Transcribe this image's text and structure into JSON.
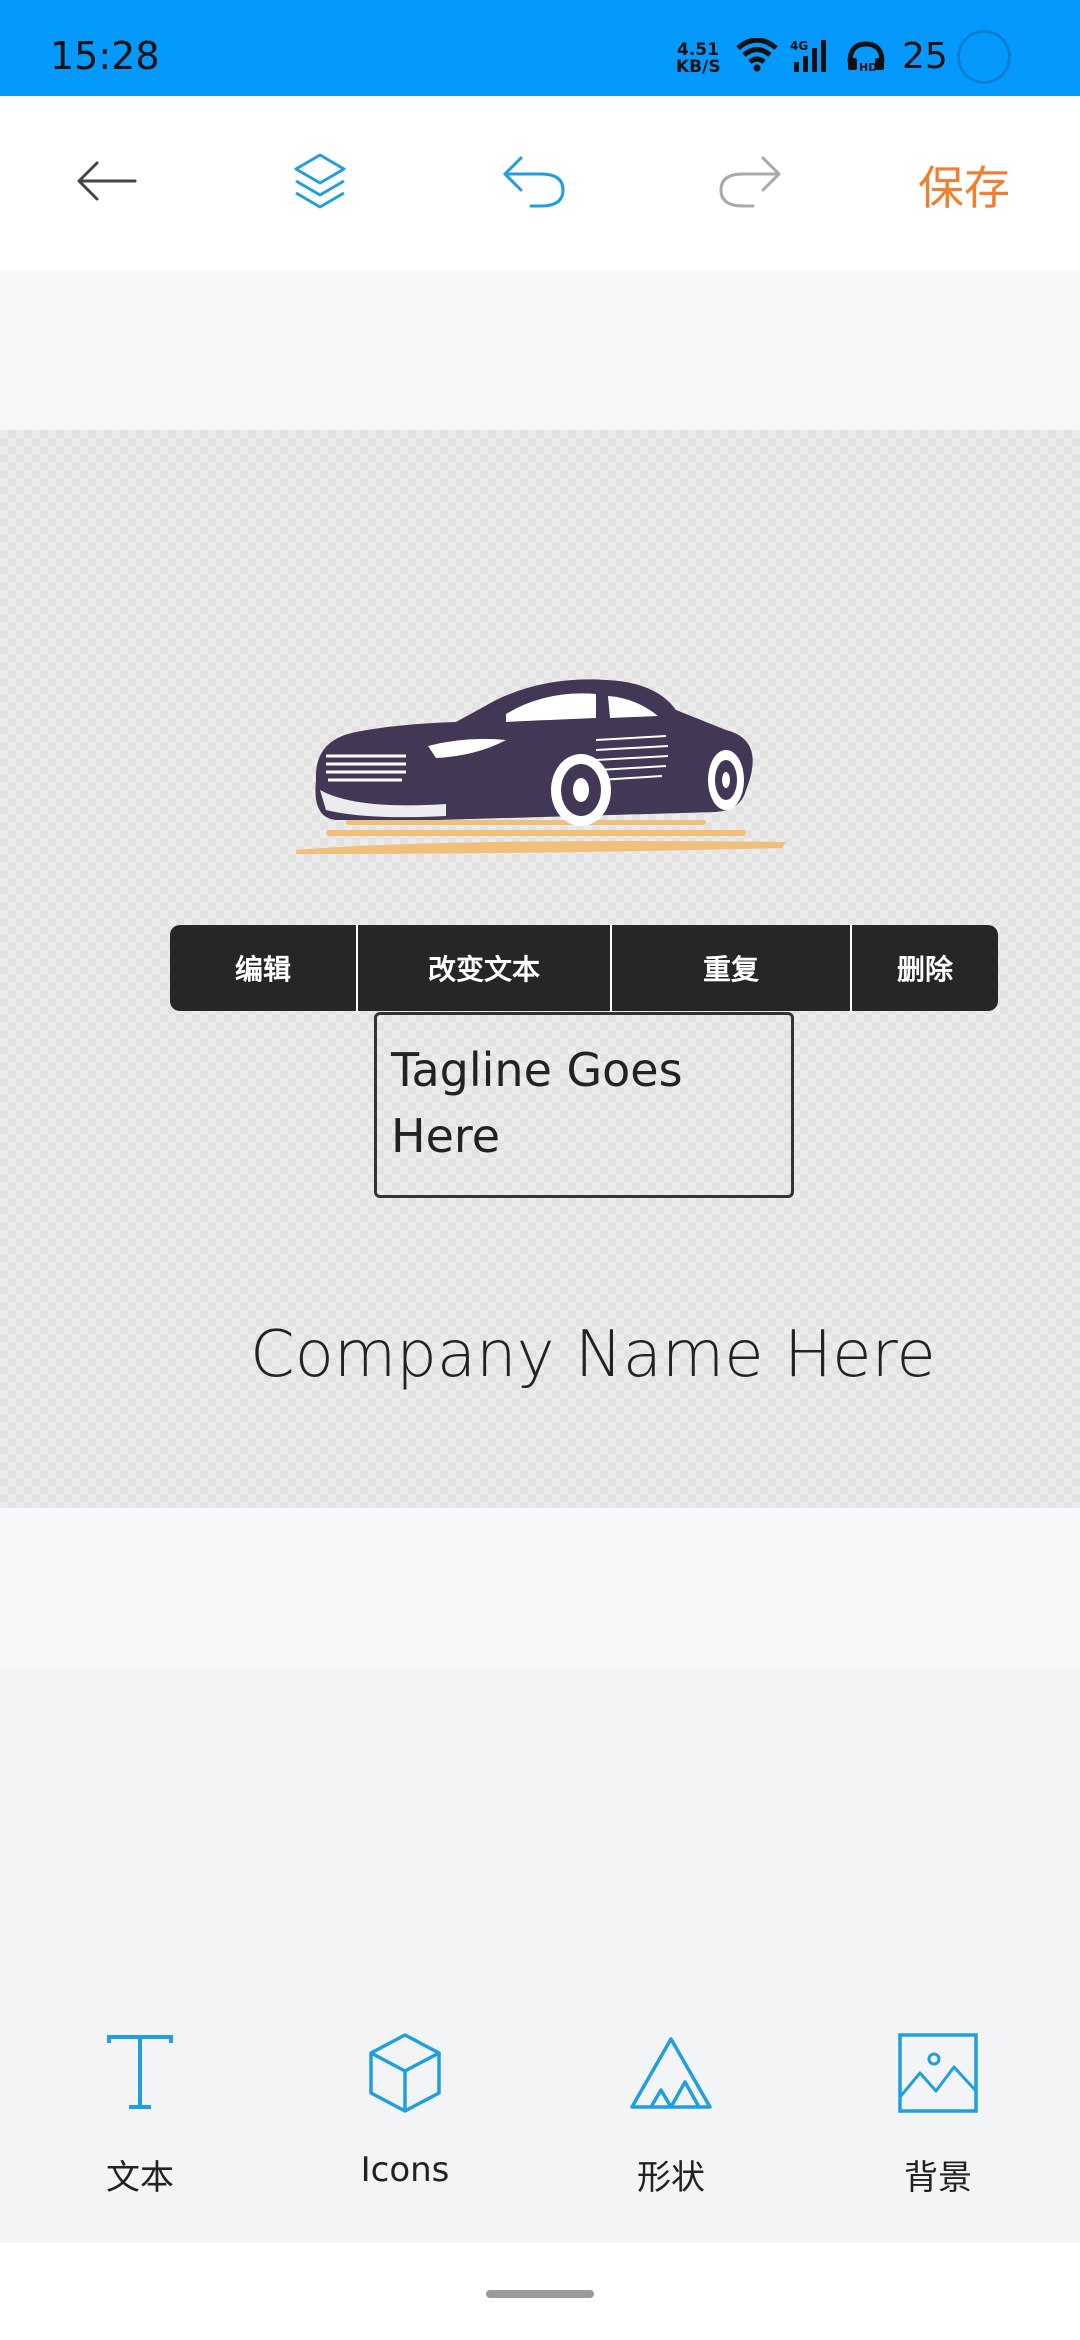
{
  "status": {
    "time": "15:28",
    "net_speed_value": "4.51",
    "net_speed_unit": "KB/S",
    "battery": "25"
  },
  "toolbar": {
    "save_label": "保存"
  },
  "canvas": {
    "company_text": "Company Name Here",
    "tagline_text": "Tagline Goes Here"
  },
  "context_menu": {
    "edit": "编辑",
    "change_text": "改变文本",
    "duplicate": "重复",
    "delete": "删除"
  },
  "bottom_nav": {
    "text_label": "文本",
    "icons_label": "Icons",
    "shape_label": "形状",
    "background_label": "背景"
  },
  "colors": {
    "accent_blue": "#1f9fe0",
    "save_orange": "#f08030",
    "status_bar": "#0499fa",
    "car_body": "#423754",
    "car_shadow": "#f0c07a"
  }
}
